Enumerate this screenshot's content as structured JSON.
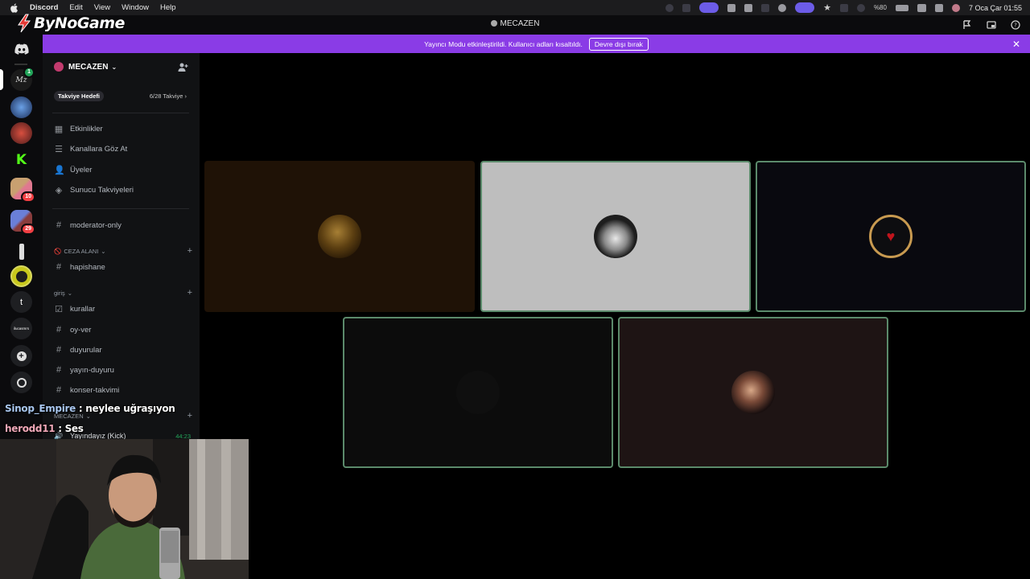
{
  "menubar": {
    "app": "Discord",
    "menus": [
      "Edit",
      "View",
      "Window",
      "Help"
    ],
    "battery": "%80",
    "datetime": "7 Oca Çar  01:55"
  },
  "window": {
    "title": "MECAZEN"
  },
  "overlay": {
    "brand": "ByNoGame"
  },
  "banner": {
    "text": "Yayıncı Modu etkinleştirildi. Kullanıcı adları kısaltıldı.",
    "button": "Devre dışı bırak"
  },
  "servers": [
    {
      "name": "mecazen",
      "badge": "1"
    },
    {
      "name": "server-2"
    },
    {
      "name": "server-3"
    },
    {
      "name": "kick"
    },
    {
      "name": "folder-1",
      "badge": "10"
    },
    {
      "name": "folder-2",
      "badge": "29"
    },
    {
      "name": "server-7"
    },
    {
      "name": "server-8"
    },
    {
      "name": "t",
      "label": "t"
    },
    {
      "name": "server-10",
      "label": "ilucasmrs"
    },
    {
      "name": "add-server"
    },
    {
      "name": "explore"
    }
  ],
  "guild": {
    "name": "MECAZEN",
    "boost_label": "Takviye Hedefi",
    "boost_progress": "6/28 Takviye",
    "nav": [
      "Etkinlikler",
      "Kanallara Göz At",
      "Üyeler",
      "Sunucu Takviyeleri"
    ],
    "channels": {
      "moderator": "moderator-only",
      "cat_ceza": "CEZA ALANI",
      "hapishane": "hapishane",
      "cat_giris": "giriş",
      "kurallar": "kurallar",
      "oy_ver": "oy-ver",
      "duyurular": "duyurular",
      "yayin_duyuru": "yayın-duyuru",
      "konser_takvimi": "konser-takvimi",
      "cat_mecazen": "MECAZEN"
    },
    "voice": {
      "name": "Yayındayız (Kick)",
      "timer": "44:23"
    }
  },
  "chat": [
    {
      "user": "Sinop_Empire",
      "sep": " : ",
      "message": "neylee uğraşıyon"
    },
    {
      "user": "herodd11",
      "sep": " : ",
      "message": "Ses"
    }
  ],
  "colors": {
    "banner": "#8a3ce6",
    "active_border": "#5b8a6b",
    "speaking_green": "#23a55a"
  }
}
